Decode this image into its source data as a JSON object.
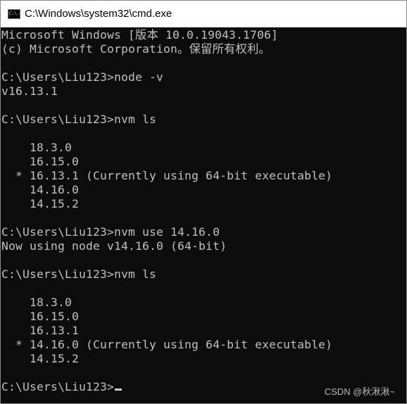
{
  "window": {
    "title": "C:\\Windows\\system32\\cmd.exe",
    "icon_label": "C:\\."
  },
  "console": {
    "lines": [
      "Microsoft Windows [版本 10.0.19043.1706]",
      "(c) Microsoft Corporation。保留所有权利。",
      "",
      "C:\\Users\\Liu123>node -v",
      "v16.13.1",
      "",
      "C:\\Users\\Liu123>nvm ls",
      "",
      "    18.3.0",
      "    16.15.0",
      "  * 16.13.1 (Currently using 64-bit executable)",
      "    14.16.0",
      "    14.15.2",
      "",
      "C:\\Users\\Liu123>nvm use 14.16.0",
      "Now using node v14.16.0 (64-bit)",
      "",
      "C:\\Users\\Liu123>nvm ls",
      "",
      "    18.3.0",
      "    16.15.0",
      "    16.13.1",
      "  * 14.16.0 (Currently using 64-bit executable)",
      "    14.15.2",
      ""
    ],
    "prompt": "C:\\Users\\Liu123>"
  },
  "watermark": "CSDN @秋湫湫~",
  "colors": {
    "background": "#0c0c0c",
    "text": "#c0c0c0",
    "titlebar": "#ffffff"
  }
}
